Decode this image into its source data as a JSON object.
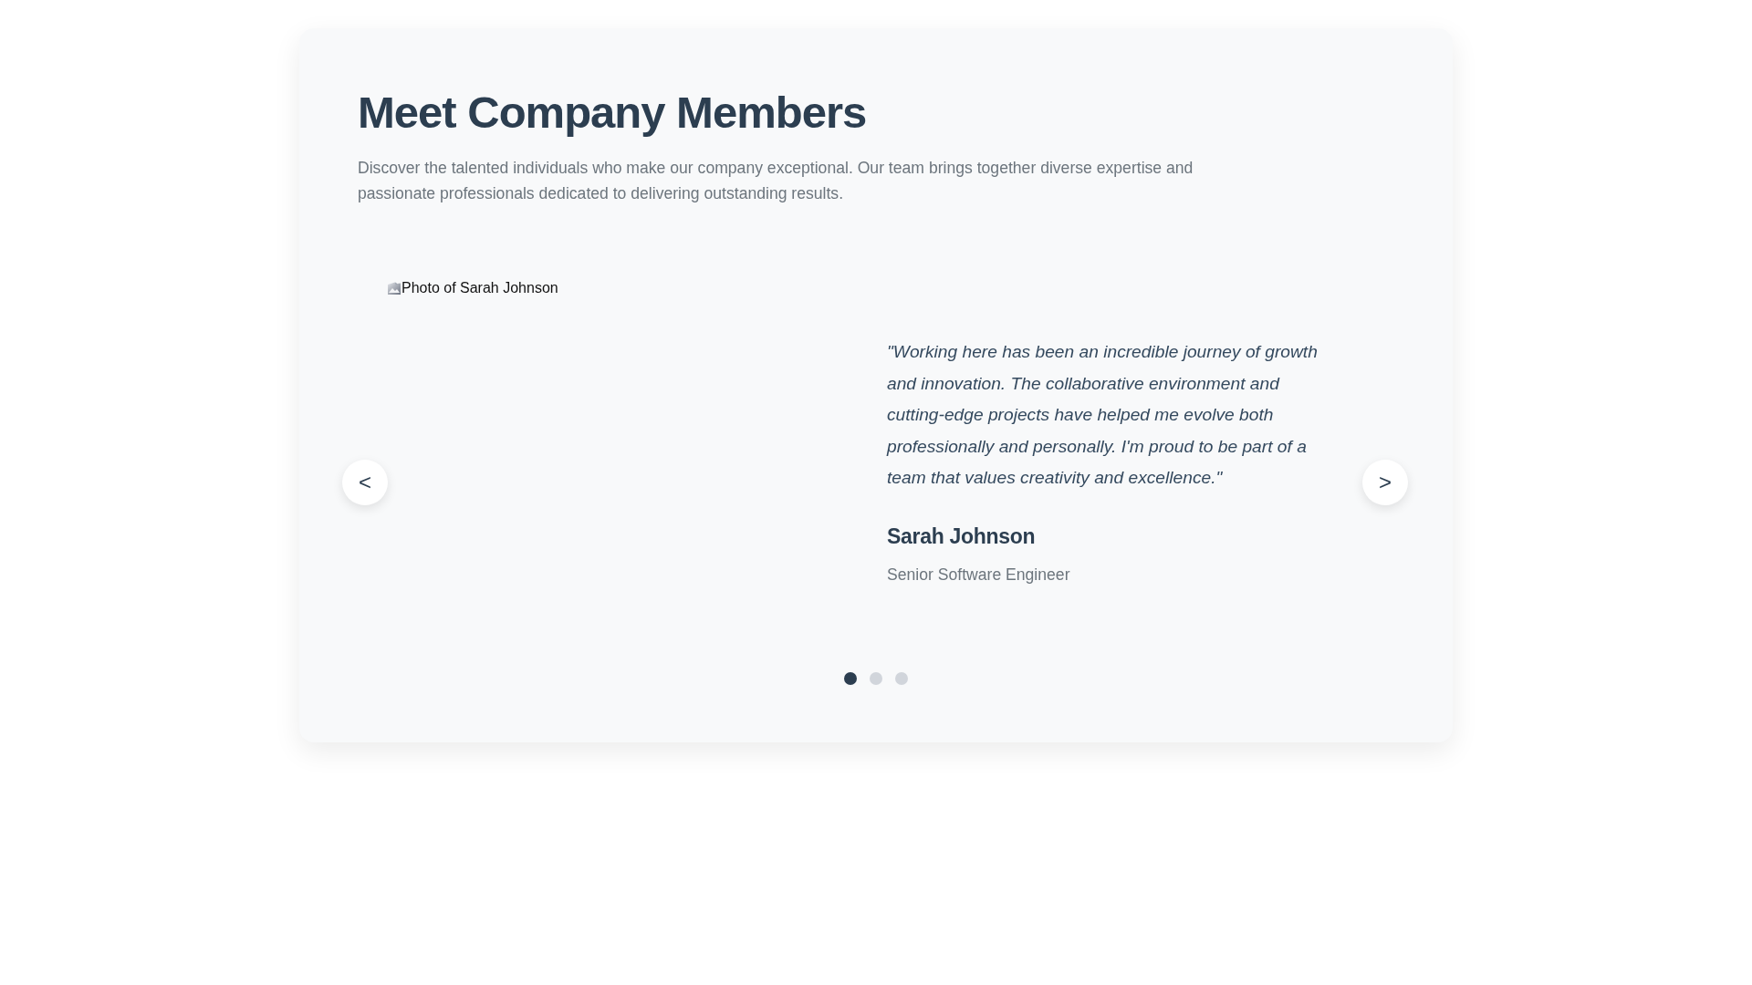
{
  "header": {
    "title": "Meet Company Members",
    "description": "Discover the talented individuals who make our company exceptional. Our team brings together diverse expertise and passionate professionals dedicated to delivering outstanding results."
  },
  "carousel": {
    "prev_button": "<",
    "next_button": ">",
    "slides": [
      {
        "photo_alt": "Photo of Sarah Johnson",
        "quote": "\"Working here has been an incredible journey of growth and innovation. The collaborative environment and cutting-edge projects have helped me evolve both professionally and personally. I'm proud to be part of a team that values creativity and excellence.\"",
        "name": "Sarah Johnson",
        "role": "Senior Software Engineer"
      }
    ],
    "dots": [
      {
        "selected": true
      },
      {
        "selected": false
      },
      {
        "selected": false
      }
    ]
  }
}
